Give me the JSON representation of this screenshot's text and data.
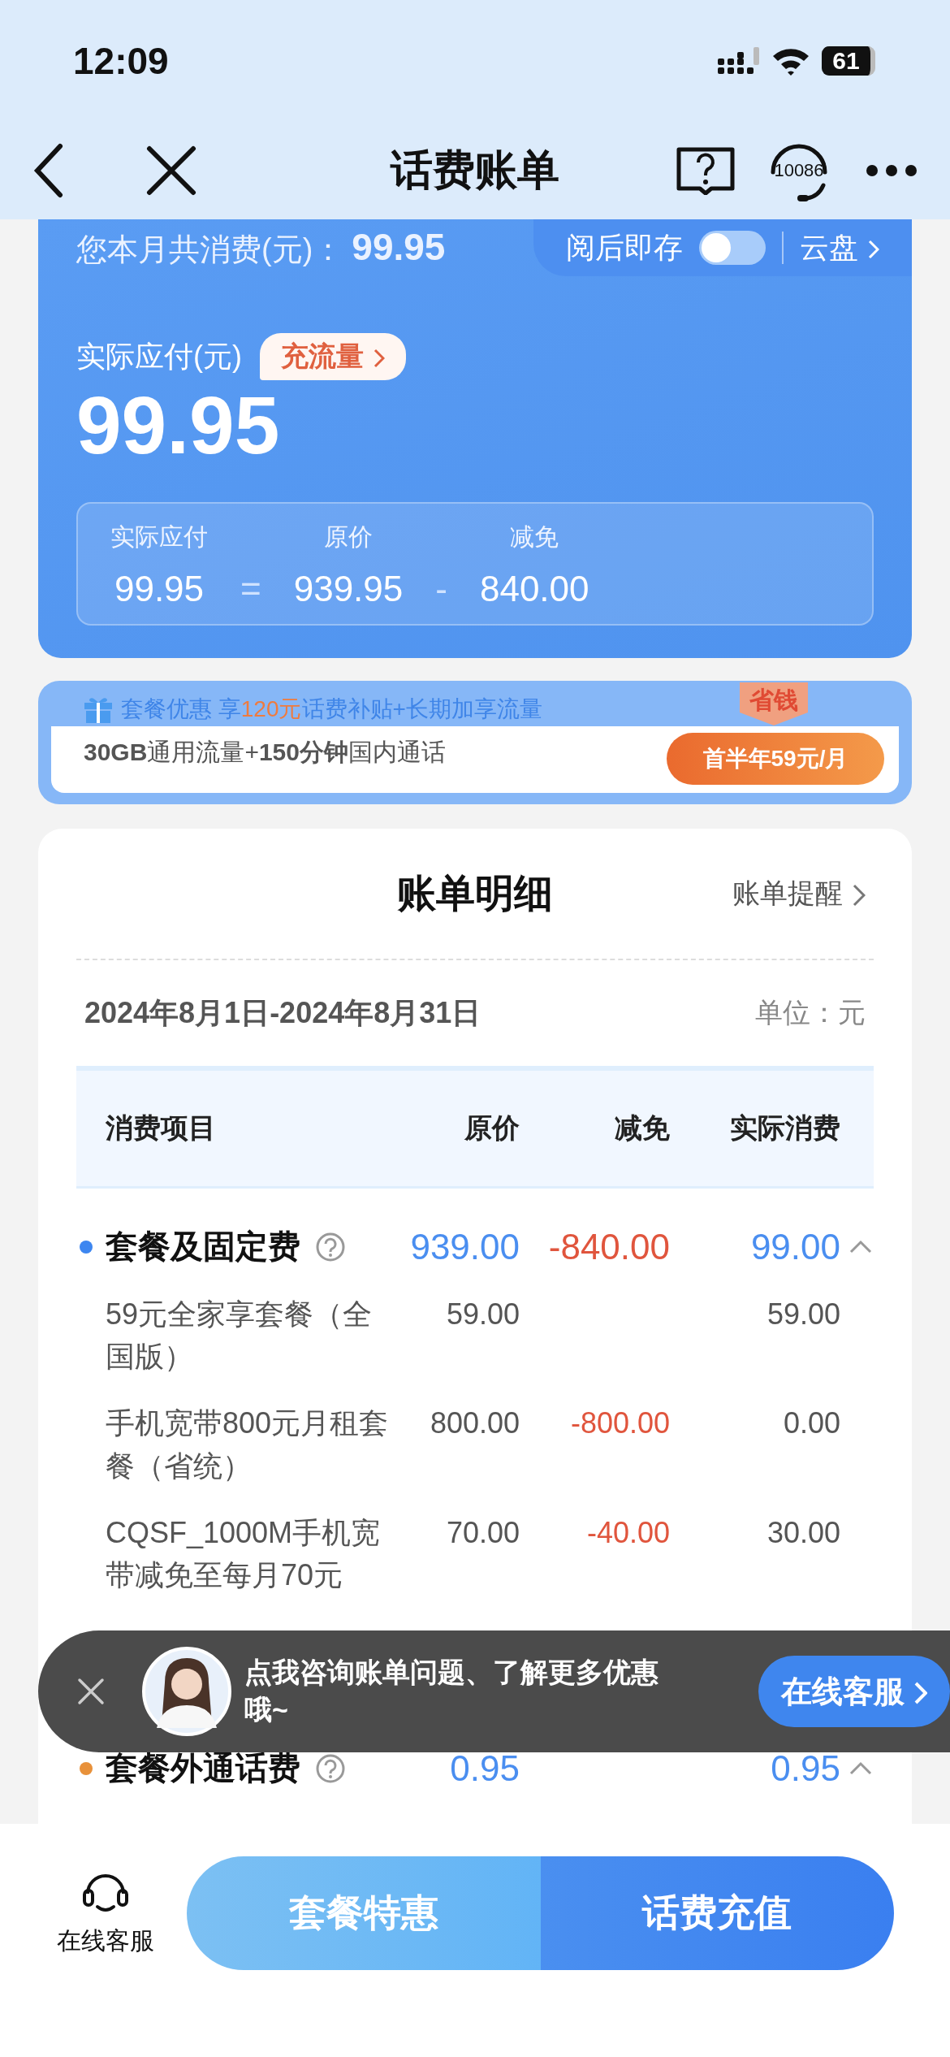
{
  "status_bar": {
    "time": "12:09",
    "battery": "61"
  },
  "nav": {
    "title": "话费账单",
    "service_number": "10086"
  },
  "summary": {
    "monthly_label": "您本月共消费(元)：",
    "monthly_total": "99.95",
    "autosave_label": "阅后即存",
    "autosave_on": false,
    "cloud_link": "云盘",
    "payable_label": "实际应付(元)",
    "topup_button": "充流量",
    "payable_amount": "99.95",
    "breakdown": [
      {
        "label": "实际应付",
        "value": "99.95"
      },
      {
        "label": "原价",
        "value": "939.95"
      },
      {
        "label": "减免",
        "value": "840.00"
      }
    ],
    "operators": [
      "=",
      "-"
    ]
  },
  "promo": {
    "headline_prefix": "套餐优惠 享",
    "headline_highlight": "120元",
    "headline_suffix": "话费补贴+长期加享流量",
    "offer": "**30GB**通用流量+**150分钟**国内通话",
    "badge": "省钱",
    "button": "首半年59元/月"
  },
  "detail": {
    "title": "账单明细",
    "reminder_link": "账单提醒",
    "period": "2024年8月1日-2024年8月31日",
    "unit": "单位：元",
    "columns": [
      "消费项目",
      "原价",
      "减免",
      "实际消费"
    ],
    "groups": [
      {
        "name": "套餐及固定费",
        "color": "#3d86f0",
        "original": "939.00",
        "discount": "-840.00",
        "actual": "99.00",
        "expanded": true,
        "items": [
          {
            "name": "59元全家享套餐（全国版）",
            "original": "59.00",
            "actual": "59.00"
          },
          {
            "name": "手机宽带800元月租套餐（省统）",
            "original": "800.00",
            "discount": "-800.00",
            "actual": "0.00"
          },
          {
            "name": "CQSF_1000M手机宽带减免至每月70元",
            "original": "70.00",
            "discount": "-40.00",
            "actual": "30.00"
          }
        ]
      },
      {
        "name": "套餐外通话费",
        "color": "#e8913a",
        "original": "0.95",
        "actual": "0.95",
        "expanded": true
      }
    ]
  },
  "chat_prompt": {
    "message": "点我咨询账单问题、了解更多优惠哦~",
    "button": "在线客服"
  },
  "bottom_bar": {
    "service_label": "在线客服",
    "buttons": [
      "套餐特惠",
      "话费充值"
    ]
  }
}
